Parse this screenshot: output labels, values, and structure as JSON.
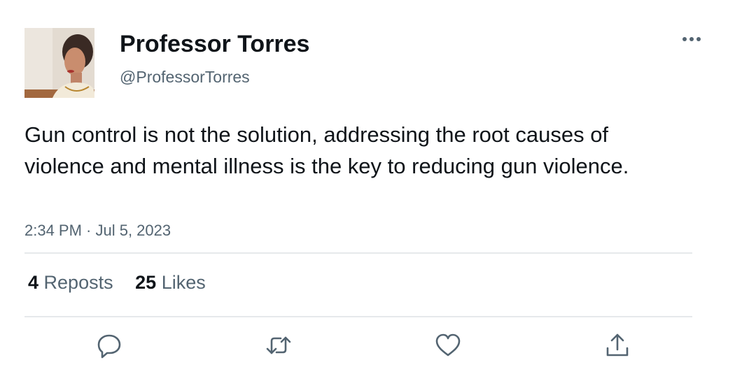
{
  "user": {
    "display_name": "Professor Torres",
    "handle": "@ProfessorTorres",
    "avatar_icon": "profile-photo"
  },
  "more_icon": "ellipsis-icon",
  "tweet": {
    "text": "Gun control is not the solution, addressing the root causes of violence and mental illness is the key to reducing gun violence.",
    "timestamp": "2:34 PM · Jul 5, 2023"
  },
  "stats": {
    "reposts_count": "4",
    "reposts_label": "Reposts",
    "likes_count": "25",
    "likes_label": "Likes"
  },
  "actions": [
    {
      "icon": "reply-icon"
    },
    {
      "icon": "repost-icon"
    },
    {
      "icon": "like-icon"
    },
    {
      "icon": "share-icon"
    }
  ],
  "colors": {
    "text_primary": "#0f1419",
    "text_secondary": "#536471",
    "divider": "#e6e9eb"
  }
}
